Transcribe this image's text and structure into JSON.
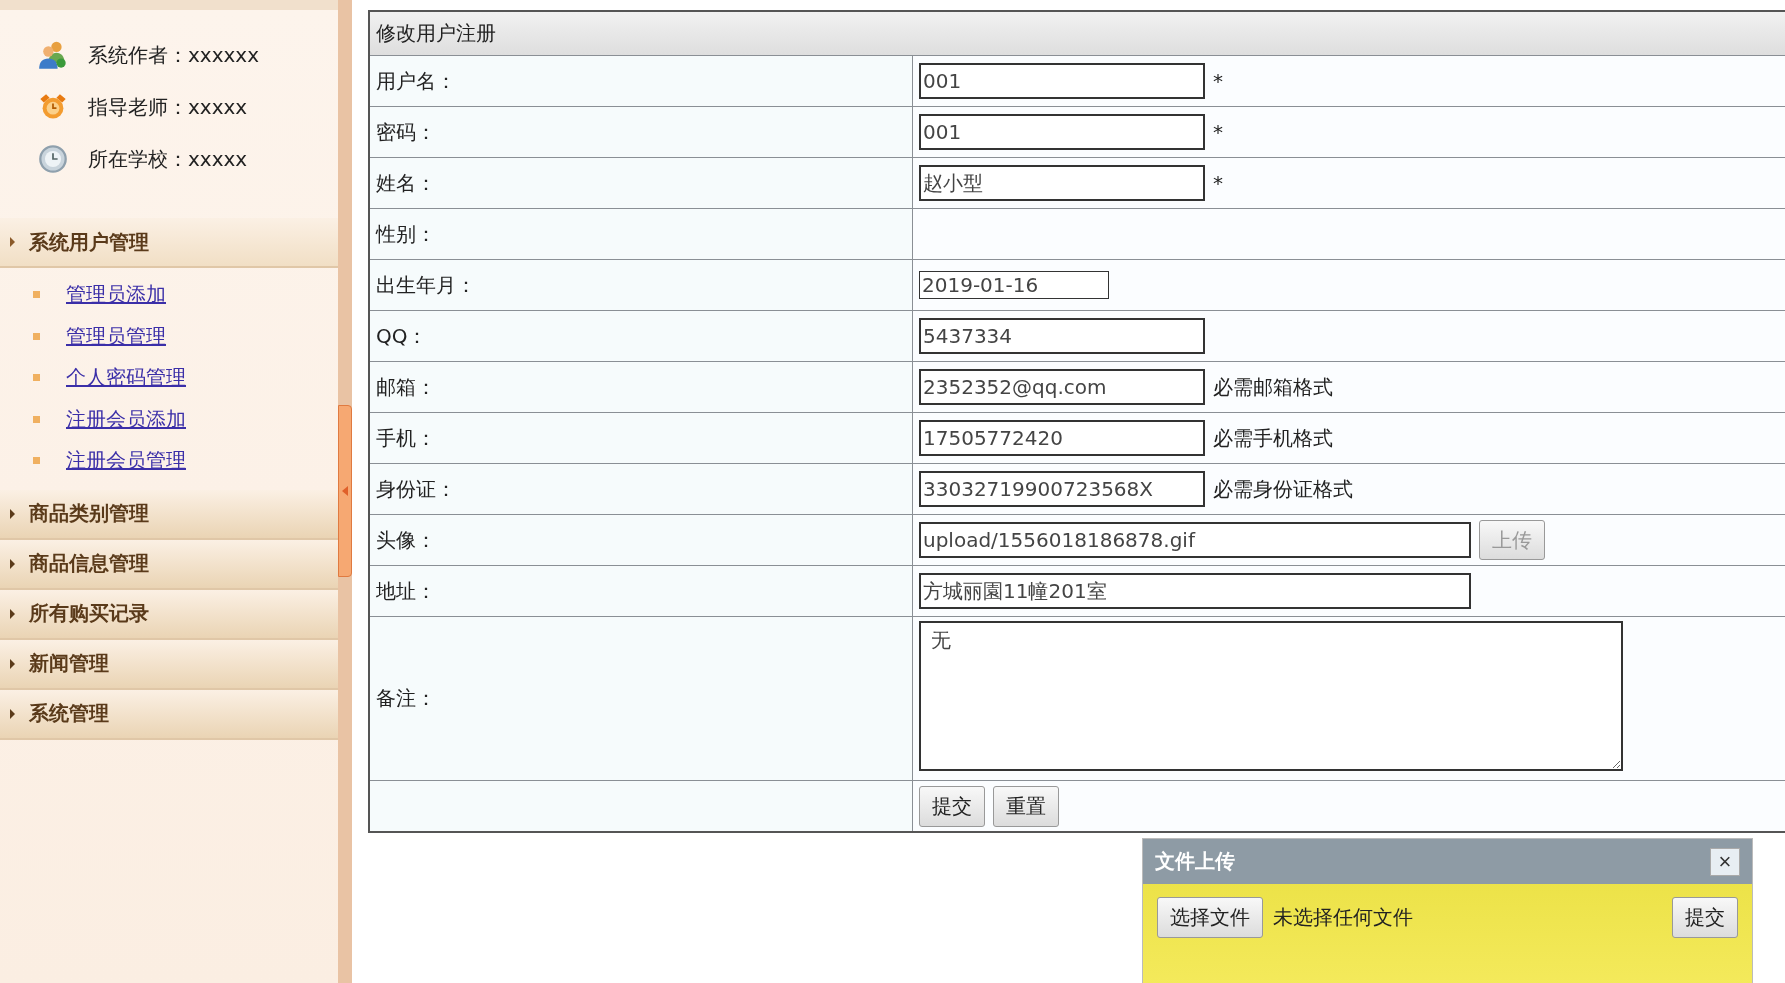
{
  "sidebar": {
    "info": [
      {
        "kind": "author",
        "text": "系统作者：xxxxxx"
      },
      {
        "kind": "teacher",
        "text": "指导老师：xxxxx"
      },
      {
        "kind": "school",
        "text": "所在学校：xxxxx"
      }
    ],
    "menu": [
      {
        "title": "系统用户管理",
        "expanded": true,
        "items": [
          "管理员添加",
          "管理员管理",
          "个人密码管理",
          "注册会员添加",
          "注册会员管理"
        ]
      },
      {
        "title": "商品类别管理",
        "expanded": false
      },
      {
        "title": "商品信息管理",
        "expanded": false
      },
      {
        "title": "所有购买记录",
        "expanded": false
      },
      {
        "title": "新闻管理",
        "expanded": false
      },
      {
        "title": "系统管理",
        "expanded": false
      }
    ]
  },
  "form": {
    "title": "修改用户注册",
    "rows": [
      {
        "label": "用户名：",
        "kind": "text",
        "value": "001",
        "note": "*"
      },
      {
        "label": "密码：",
        "kind": "text",
        "value": "001",
        "note": "*"
      },
      {
        "label": "姓名：",
        "kind": "text",
        "value": "赵小型",
        "note": "*"
      },
      {
        "label": "性别：",
        "kind": "empty"
      },
      {
        "label": "出生年月：",
        "kind": "date",
        "value": "2019-01-16"
      },
      {
        "label": "QQ：",
        "kind": "text",
        "value": "5437334"
      },
      {
        "label": "邮箱：",
        "kind": "text",
        "value": "2352352@qq.com",
        "note": "必需邮箱格式"
      },
      {
        "label": "手机：",
        "kind": "text",
        "value": "17505772420",
        "note": "必需手机格式"
      },
      {
        "label": "身份证：",
        "kind": "text",
        "value": "33032719900723568X",
        "note": "必需身份证格式"
      },
      {
        "label": "头像：",
        "kind": "upload",
        "value": "upload/1556018186878.gif",
        "button": "上传"
      },
      {
        "label": "地址：",
        "kind": "long",
        "value": "方城丽園11幢201室"
      },
      {
        "label": "备注：",
        "kind": "textarea",
        "value": "无"
      }
    ],
    "buttons": [
      "提交",
      "重置"
    ]
  },
  "upload_dialog": {
    "title": "文件上传",
    "close": "×",
    "choose_button": "选择文件",
    "status": "未选择任何文件",
    "submit": "提交"
  }
}
